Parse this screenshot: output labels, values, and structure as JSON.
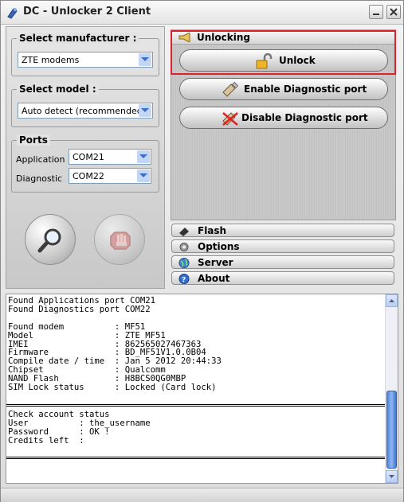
{
  "window": {
    "title": "DC - Unlocker 2 Client"
  },
  "left": {
    "manufacturer": {
      "label": "Select manufacturer :",
      "value": "ZTE modems"
    },
    "model": {
      "label": "Select model :",
      "value": "Auto detect (recommended)"
    },
    "ports": {
      "label": "Ports",
      "application_label": "Application",
      "application_value": "COM21",
      "diagnostic_label": "Diagnostic",
      "diagnostic_value": "COM22"
    },
    "buttons": {
      "search_icon": "magnifier-icon",
      "stop_icon": "stop-hand-icon"
    }
  },
  "right": {
    "section_title": "Unlocking",
    "unlock_label": "Unlock",
    "enable_diag_label": "Enable Diagnostic port",
    "disable_diag_label": "Disable Diagnostic port"
  },
  "nav": {
    "flash": "Flash",
    "options": "Options",
    "server": "Server",
    "about": "About"
  },
  "log": {
    "block1": "Found Applications port COM21\nFound Diagnostics port COM22\n\nFound modem          : MF51\nModel                : ZTE MF51\nIMEI                 : 862565027467363\nFirmware             : BD_MF51V1.0.0B04\nCompile date / time  : Jan 5 2012 20:44:33\nChipset              : Qualcomm\nNAND Flash           : H8BCS0QG0MBP\nSIM Lock status      : Locked (Card lock)",
    "block2": "Check account status\nUser          : the_username\nPassword      : OK !\nCredits left  :"
  },
  "colors": {
    "highlight": "#e0202a",
    "scrollbar": "#4f86d9"
  }
}
